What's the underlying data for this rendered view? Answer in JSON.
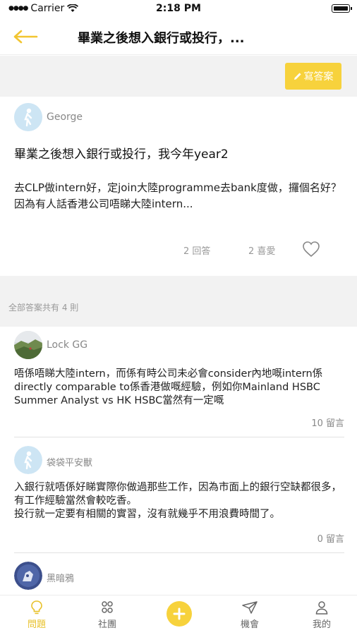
{
  "status_bar": {
    "carrier": "Carrier",
    "time": "2:18 PM"
  },
  "nav": {
    "title": "畢業之後想入銀行或投行，..."
  },
  "write_button": {
    "label": "寫答案"
  },
  "question": {
    "author": "George",
    "title": "畢業之後想入銀行或投行，我今年year2",
    "body": "去CLP做intern好，定join大陸programme去bank度做，攞個名好？因為有人話香港公司唔睇大陸intern...",
    "answers_count": "2 回答",
    "likes_count": "2 喜愛"
  },
  "answers_header": {
    "label": "全部答案共有 4 則"
  },
  "answers": [
    {
      "author": "Lock GG",
      "text": "唔係唔睇大陸intern，而係有時公司未必會consider內地嘅intern係directly comparable to係香港做嘅經驗，例如你Mainland HSBC Summer Analyst vs HK HSBC當然有一定嘅",
      "comments": "10 留言"
    },
    {
      "author": "袋袋平安獸",
      "text": "入銀行就唔係好睇實際你做過那些工作，因為市面上的銀行空缺都很多，有工作經驗當然會較吃香。\n投行就一定要有相關的實習，沒有就幾乎不用浪費時間了。",
      "comments": "0 留言"
    },
    {
      "author": "黑暗鴉"
    }
  ],
  "tabs": [
    {
      "label": "問題",
      "icon": "lightbulb-icon",
      "active": true
    },
    {
      "label": "社團",
      "icon": "groups-icon",
      "active": false
    },
    {
      "label": "機會",
      "icon": "paper-plane-icon",
      "active": false
    },
    {
      "label": "我的",
      "icon": "profile-icon",
      "active": false
    }
  ],
  "colors": {
    "accent": "#f7d23c",
    "accent_text": "#e8c12a",
    "section_bg": "#f2f2f2"
  }
}
